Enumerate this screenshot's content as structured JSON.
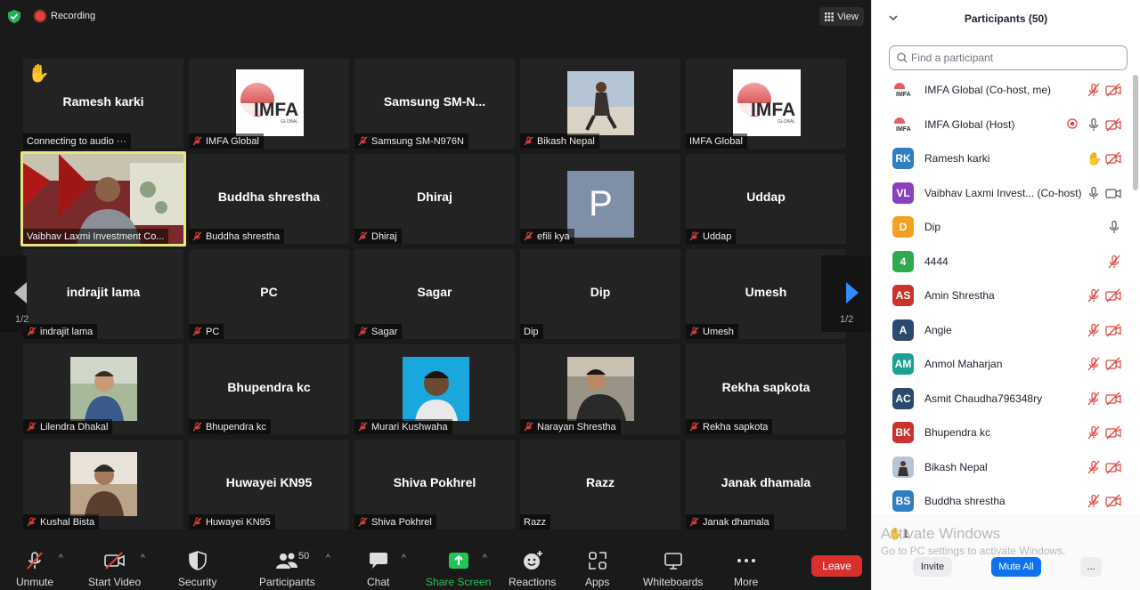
{
  "topbar": {
    "recording": "Recording",
    "view": "View"
  },
  "tiles": [
    {
      "name": "Ramesh karki",
      "label": "Connecting to audio ···",
      "muted": false,
      "hand": true
    },
    {
      "name": "",
      "label": "IMFA Global",
      "muted": true,
      "logo": true
    },
    {
      "name": "Samsung  SM-N...",
      "label": "Samsung SM-N976N",
      "muted": true
    },
    {
      "name": "",
      "label": "Bikash Nepal",
      "muted": true,
      "photo": "bikash"
    },
    {
      "name": "",
      "label": "IMFA Global",
      "muted": false,
      "logo": true
    },
    {
      "name": "",
      "label": "Vaibhav Laxmi Investment Co...",
      "muted": false,
      "video": true
    },
    {
      "name": "Buddha shrestha",
      "label": "Buddha shrestha",
      "muted": true
    },
    {
      "name": "Dhiraj",
      "label": "Dhiraj",
      "muted": true
    },
    {
      "name": "",
      "label": "efili kya",
      "muted": true,
      "letter": "P"
    },
    {
      "name": "Uddap",
      "label": "Uddap",
      "muted": true
    },
    {
      "name": "indrajit lama",
      "label": "indrajit lama",
      "muted": true
    },
    {
      "name": "PC",
      "label": "PC",
      "muted": true
    },
    {
      "name": "Sagar",
      "label": "Sagar",
      "muted": true
    },
    {
      "name": "Dip",
      "label": "Dip",
      "muted": false
    },
    {
      "name": "Umesh",
      "label": "Umesh",
      "muted": true
    },
    {
      "name": "",
      "label": "Lilendra Dhakal",
      "muted": true,
      "photo": "lilendra"
    },
    {
      "name": "Bhupendra kc",
      "label": "Bhupendra kc",
      "muted": true
    },
    {
      "name": "",
      "label": "Murari Kushwaha",
      "muted": true,
      "photo": "murari"
    },
    {
      "name": "",
      "label": "Narayan Shrestha",
      "muted": true,
      "photo": "narayan"
    },
    {
      "name": "Rekha sapkota",
      "label": "Rekha sapkota",
      "muted": true
    },
    {
      "name": "",
      "label": "Kushal Bista",
      "muted": true,
      "photo": "kushal"
    },
    {
      "name": "Huwayei KN95",
      "label": "Huwayei KN95",
      "muted": true
    },
    {
      "name": "Shiva Pokhrel",
      "label": "Shiva Pokhrel",
      "muted": true
    },
    {
      "name": "Razz",
      "label": "Razz",
      "muted": false
    },
    {
      "name": "Janak dhamala",
      "label": "Janak dhamala",
      "muted": true
    }
  ],
  "pager": {
    "left": "1/2",
    "right": "1/2"
  },
  "toolbar": {
    "unmute": "Unmute",
    "start_video": "Start Video",
    "security": "Security",
    "participants": "Participants",
    "participants_count": "50",
    "chat": "Chat",
    "share_screen": "Share Screen",
    "reactions": "Reactions",
    "apps": "Apps",
    "whiteboards": "Whiteboards",
    "more": "More",
    "leave": "Leave"
  },
  "panel": {
    "title": "Participants (50)",
    "search_placeholder": "Find a participant",
    "participants": [
      {
        "initials": "",
        "name": "IMFA Global (Co-host, me)",
        "color": "#ffffff",
        "logo": true,
        "icons": [
          "mic-off",
          "video-off"
        ]
      },
      {
        "initials": "",
        "name": "IMFA Global (Host)",
        "color": "#ffffff",
        "logo": true,
        "icons": [
          "record",
          "mic",
          "video-off"
        ]
      },
      {
        "initials": "RK",
        "name": "Ramesh karki",
        "color": "#2f7fc1",
        "icons": [
          "hand",
          "video-off"
        ]
      },
      {
        "initials": "VL",
        "name": "Vaibhav Laxmi Invest... (Co-host)",
        "color": "#8a3fbf",
        "icons": [
          "mic",
          "video"
        ]
      },
      {
        "initials": "D",
        "name": "Dip",
        "color": "#f5a020",
        "icons": [
          "mic"
        ]
      },
      {
        "initials": "4",
        "name": "4444",
        "color": "#2eaa4e",
        "icons": [
          "mic-off"
        ]
      },
      {
        "initials": "AS",
        "name": "Amin Shrestha",
        "color": "#c9342d",
        "icons": [
          "mic-off",
          "video-off"
        ]
      },
      {
        "initials": "A",
        "name": "Angie",
        "color": "#2c4a70",
        "icons": [
          "mic-off",
          "video-off"
        ]
      },
      {
        "initials": "AM",
        "name": "Anmol Maharjan",
        "color": "#1aa393",
        "icons": [
          "mic-off",
          "video-off"
        ]
      },
      {
        "initials": "AC",
        "name": "Asmit Chaudha796348ry",
        "color": "#2c4a70",
        "icons": [
          "mic-off",
          "video-off"
        ]
      },
      {
        "initials": "BK",
        "name": "Bhupendra kc",
        "color": "#c9342d",
        "icons": [
          "mic-off",
          "video-off"
        ]
      },
      {
        "initials": "",
        "name": "Bikash Nepal",
        "color": "#8aa0b8",
        "photo": true,
        "icons": [
          "mic-off",
          "video-off"
        ]
      },
      {
        "initials": "BS",
        "name": "Buddha shrestha",
        "color": "#2f7fc1",
        "icons": [
          "mic-off",
          "video-off"
        ]
      }
    ],
    "raised_count": "1",
    "watermark_title": "Activate Windows",
    "watermark_sub": "Go to PC settings to activate Windows.",
    "invite": "Invite",
    "mute_all": "Mute All",
    "more": "..."
  },
  "colors": {
    "leave": "#d9302e",
    "accent": "#0e72ed",
    "share": "#20c55a",
    "active_border": "#e6e680"
  }
}
